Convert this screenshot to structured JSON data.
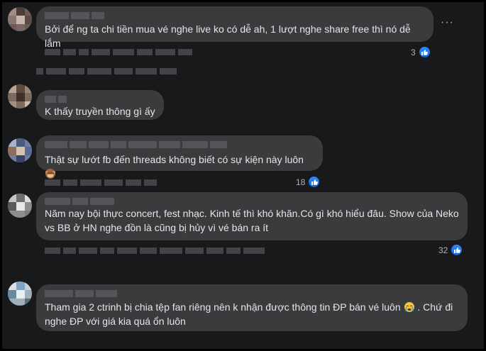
{
  "comments": [
    {
      "text": "Bởi để ng ta chi tiền mua vé nghe live ko có dễ ah, 1 lượt nghe share free thì nó dễ lắm",
      "likes": "3"
    },
    {
      "text": "K thấy truyền thông gì ấy",
      "likes": ""
    },
    {
      "text": "Thật sự lướt fb đến threads không biết có sự kiện này luôn",
      "likes": "18",
      "emoji": "monkey-emoji"
    },
    {
      "text_line1": "Năm nay bội thực concert, fest nhạc. Kinh tế thì khó khăn.Có gì khó hiểu đâu. Show của Neko",
      "text_line2": "vs BB ở HN nghe đồn là cũng bị hủy vì vé bán ra ít",
      "likes": "32"
    },
    {
      "text_part1": "Tham gia 2 ctrinh bị chia tệp fan riêng nên k nhận được thông tin ĐP bán vé luôn",
      "text_part2": ". Chứ đi",
      "text_line2": "nghe ĐP với giá kia quá ổn luôn",
      "likes": "",
      "emoji": "crying-emoji"
    }
  ],
  "more_label": "···",
  "colors": {
    "bubble": "#3a3b3c",
    "background": "#18191a",
    "like": "#1877f2",
    "text": "#e4e6eb"
  }
}
